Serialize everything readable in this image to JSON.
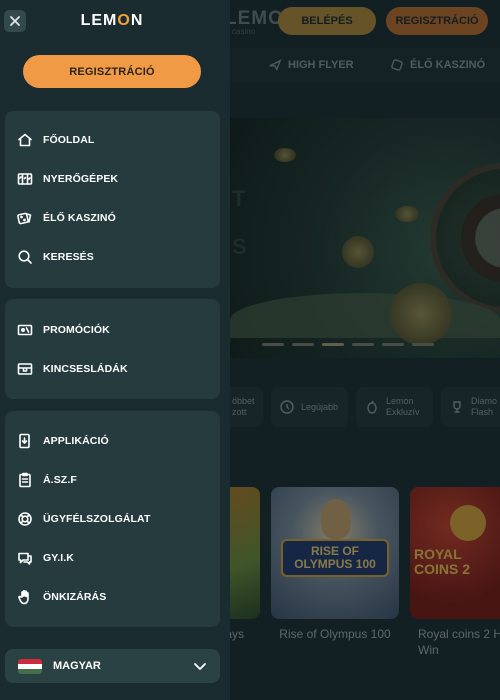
{
  "background": {
    "logo": "LEMO",
    "logo_sub": "casino",
    "login_label": "BELÉPÉS",
    "register_label": "REGISZTRÁCIÓ",
    "nav": [
      {
        "label": "HIGH FLYER",
        "icon": "plane-icon"
      },
      {
        "label": "ÉLŐ KASZINÓ",
        "icon": "live-casino-icon"
      }
    ],
    "hero_text": [
      "T",
      "S"
    ],
    "categories": [
      {
        "label": "öbbet\nzott",
        "icon": "trending-icon"
      },
      {
        "label": "Legújabb",
        "icon": "clock-icon"
      },
      {
        "label": "Lemon\nExkluzív",
        "icon": "lemon-icon"
      },
      {
        "label": "Diamo\nFlash",
        "icon": "trophy-icon"
      }
    ],
    "games": [
      {
        "title": "ays"
      },
      {
        "title": "Rise of Olympus 100",
        "art_text": "RISE OF OLYMPUS 100"
      },
      {
        "title": "Royal coins 2 Ho\nWin",
        "art_text": "ROYAL COINS 2"
      }
    ]
  },
  "drawer": {
    "logo_part1": "LEM",
    "logo_o": "O",
    "logo_part2": "N",
    "register_label": "REGISZTRÁCIÓ",
    "section1": [
      {
        "label": "FŐOLDAL",
        "icon": "home-icon"
      },
      {
        "label": "NYERŐGÉPEK",
        "icon": "slot-machine-icon"
      },
      {
        "label": "ÉLŐ KASZINÓ",
        "icon": "dice-icon"
      },
      {
        "label": "KERESÉS",
        "icon": "search-icon"
      }
    ],
    "section2": [
      {
        "label": "PROMÓCIÓK",
        "icon": "promo-icon"
      },
      {
        "label": "KINCSESLÁDÁK",
        "icon": "treasure-chest-icon"
      }
    ],
    "section3": [
      {
        "label": "APPLIKÁCIÓ",
        "icon": "app-download-icon"
      },
      {
        "label": "Á.SZ.F",
        "icon": "terms-icon"
      },
      {
        "label": "ÜGYFÉLSZOLGÁLAT",
        "icon": "support-icon"
      },
      {
        "label": "GY.I.K",
        "icon": "faq-chat-icon"
      },
      {
        "label": "ÖNKIZÁRÁS",
        "icon": "hand-icon"
      }
    ],
    "language": "MAGYAR"
  },
  "colors": {
    "accent": "#f09a45",
    "login": "#b58b3b",
    "drawer_bg": "#1b2c30",
    "card_bg": "#253b3e",
    "flag": [
      "#cd2a3e",
      "#ffffff",
      "#436f4d"
    ]
  }
}
